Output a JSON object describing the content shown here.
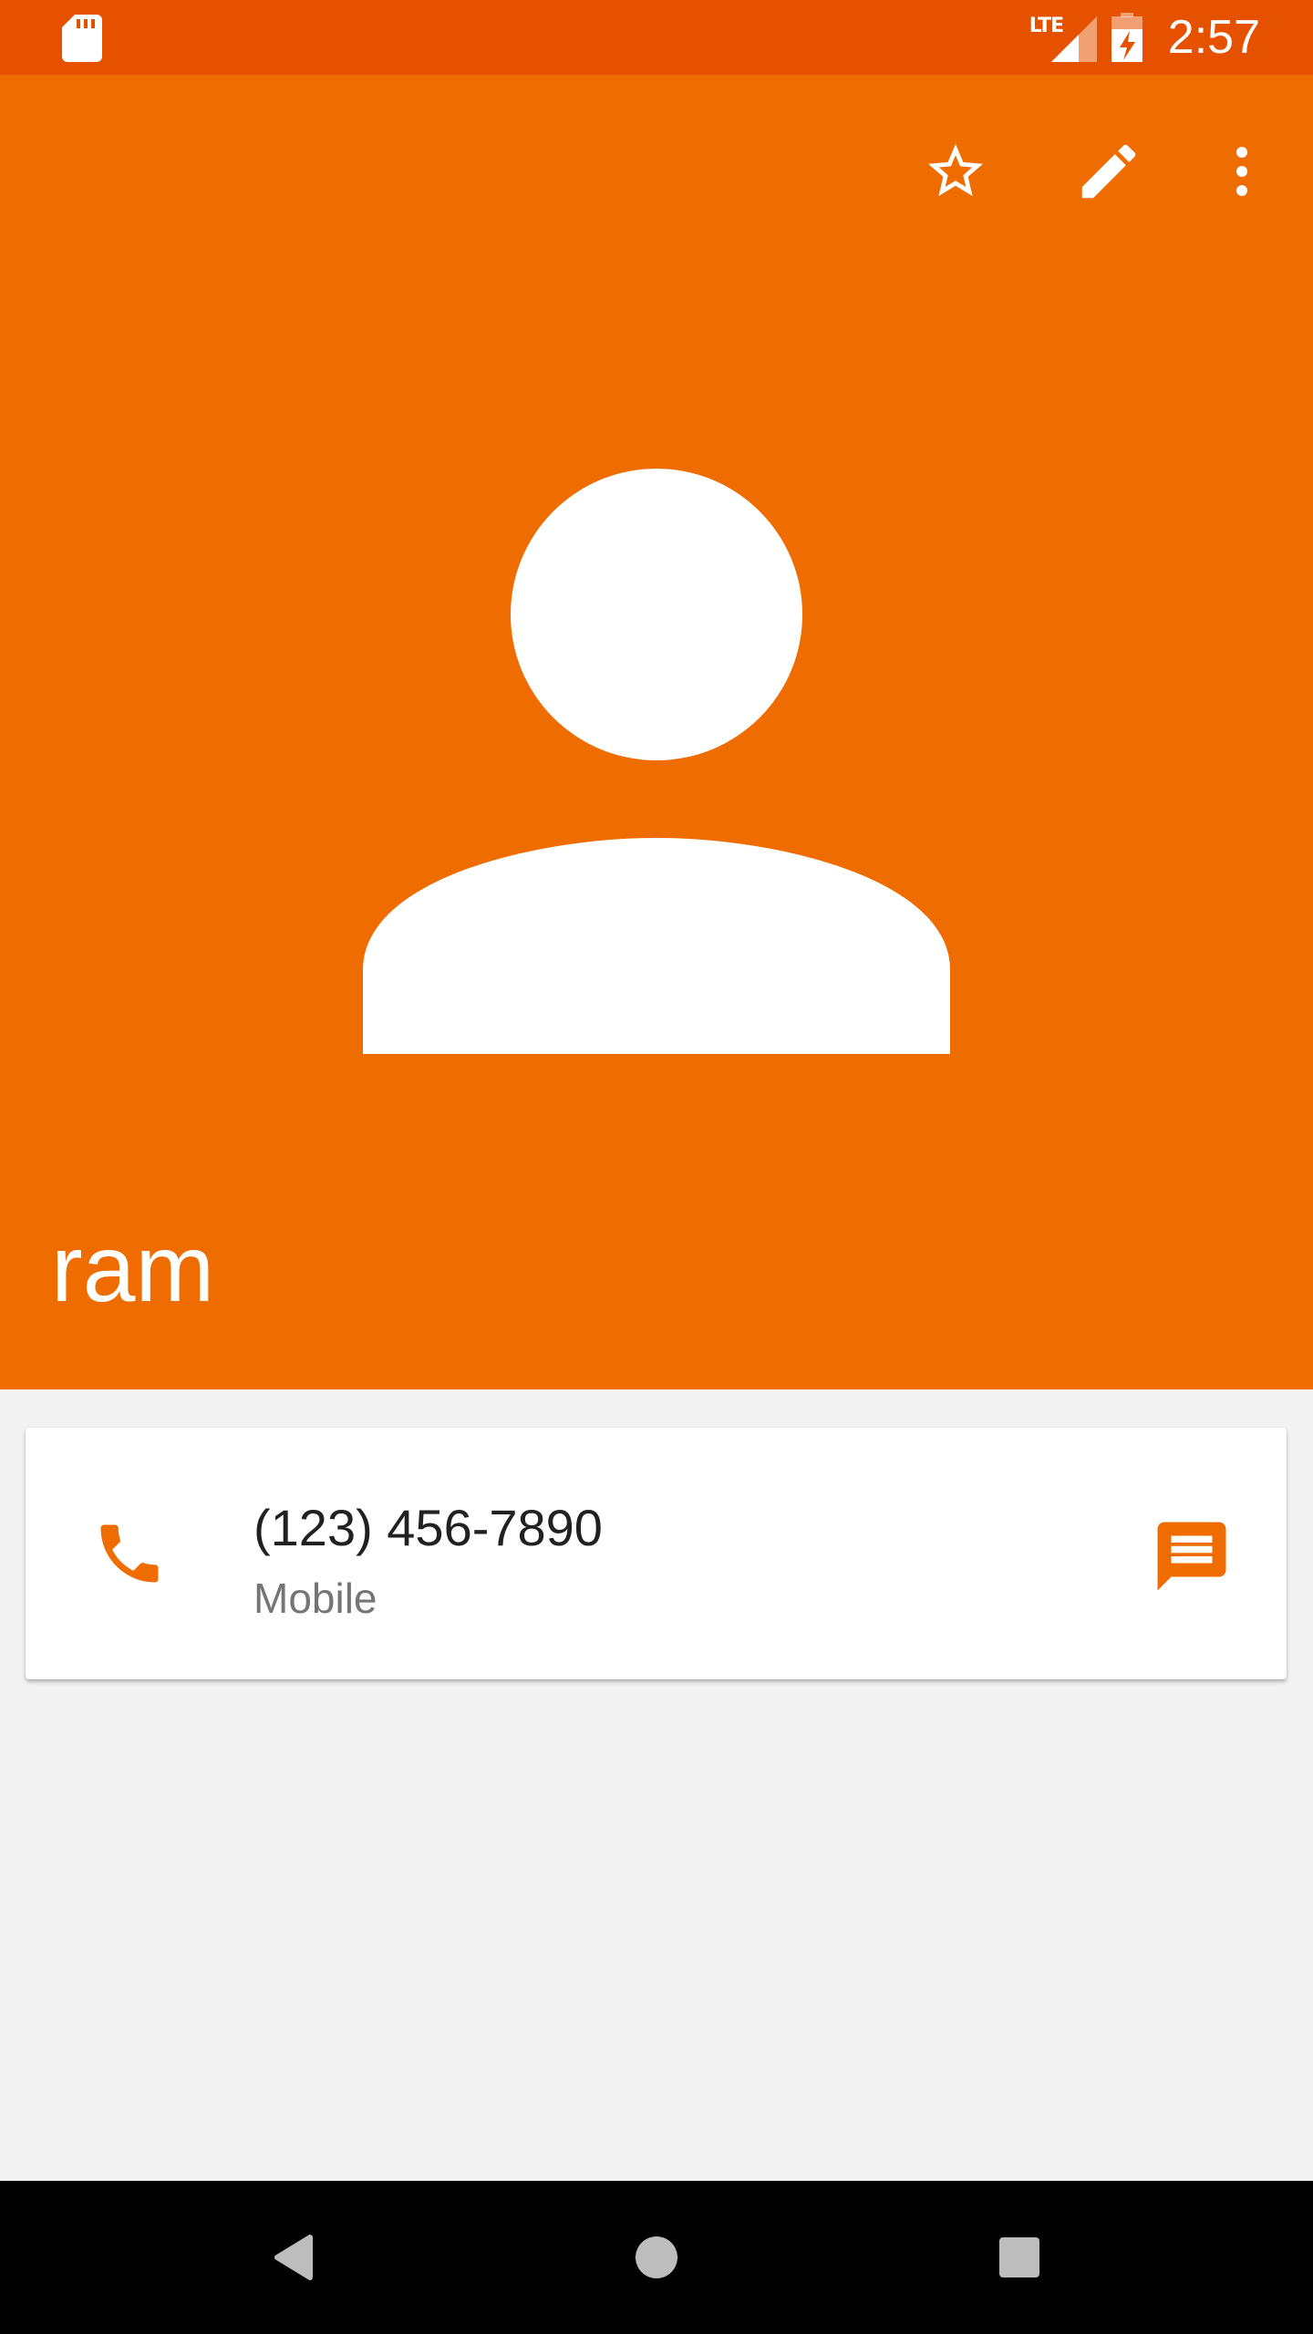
{
  "status_bar": {
    "network_label": "LTE",
    "time": "2:57",
    "icons": [
      "sd-card-icon",
      "signal-icon",
      "battery-charging-icon"
    ]
  },
  "header": {
    "contact_name": "ram",
    "actions": [
      "star-icon",
      "edit-icon",
      "more-vert-icon"
    ],
    "avatar_icon": "person-avatar-icon"
  },
  "contact_card": {
    "phone_number": "(123) 456-7890",
    "phone_type": "Mobile",
    "call_icon": "phone-icon",
    "message_icon": "message-icon"
  },
  "nav_bar": {
    "buttons": [
      "back-icon",
      "home-icon",
      "recents-icon"
    ]
  },
  "colors": {
    "status_bar": "#e65100",
    "header": "#ef6c00",
    "accent": "#ef6c00",
    "background": "#f2f2f2"
  }
}
